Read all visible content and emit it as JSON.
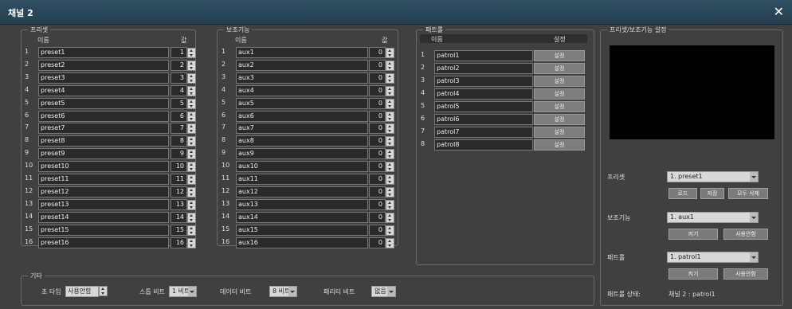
{
  "window": {
    "title": "채널 2"
  },
  "preset": {
    "legend": "프리셋",
    "col_name": "이름",
    "col_value": "값",
    "rows": [
      {
        "num": "1",
        "name": "preset1",
        "value": "1"
      },
      {
        "num": "2",
        "name": "preset2",
        "value": "2"
      },
      {
        "num": "3",
        "name": "preset3",
        "value": "3"
      },
      {
        "num": "4",
        "name": "preset4",
        "value": "4"
      },
      {
        "num": "5",
        "name": "preset5",
        "value": "5"
      },
      {
        "num": "6",
        "name": "preset6",
        "value": "6"
      },
      {
        "num": "7",
        "name": "preset7",
        "value": "7"
      },
      {
        "num": "8",
        "name": "preset8",
        "value": "8"
      },
      {
        "num": "9",
        "name": "preset9",
        "value": "9"
      },
      {
        "num": "10",
        "name": "preset10",
        "value": "10"
      },
      {
        "num": "11",
        "name": "preset11",
        "value": "11"
      },
      {
        "num": "12",
        "name": "preset12",
        "value": "12"
      },
      {
        "num": "13",
        "name": "preset13",
        "value": "13"
      },
      {
        "num": "14",
        "name": "preset14",
        "value": "14"
      },
      {
        "num": "15",
        "name": "preset15",
        "value": "15"
      },
      {
        "num": "16",
        "name": "preset16",
        "value": "16"
      }
    ]
  },
  "aux": {
    "legend": "보조기능",
    "col_name": "이름",
    "col_value": "값",
    "rows": [
      {
        "num": "1",
        "name": "aux1",
        "value": "0"
      },
      {
        "num": "2",
        "name": "aux2",
        "value": "0"
      },
      {
        "num": "3",
        "name": "aux3",
        "value": "0"
      },
      {
        "num": "4",
        "name": "aux4",
        "value": "0"
      },
      {
        "num": "5",
        "name": "aux5",
        "value": "0"
      },
      {
        "num": "6",
        "name": "aux6",
        "value": "0"
      },
      {
        "num": "7",
        "name": "aux7",
        "value": "0"
      },
      {
        "num": "8",
        "name": "aux8",
        "value": "0"
      },
      {
        "num": "9",
        "name": "aux9",
        "value": "0"
      },
      {
        "num": "10",
        "name": "aux10",
        "value": "0"
      },
      {
        "num": "11",
        "name": "aux11",
        "value": "0"
      },
      {
        "num": "12",
        "name": "aux12",
        "value": "0"
      },
      {
        "num": "13",
        "name": "aux13",
        "value": "0"
      },
      {
        "num": "14",
        "name": "aux14",
        "value": "0"
      },
      {
        "num": "15",
        "name": "aux15",
        "value": "0"
      },
      {
        "num": "16",
        "name": "aux16",
        "value": "0"
      }
    ]
  },
  "patrol": {
    "legend": "패트롤",
    "col_name": "이름",
    "col_setting": "설정",
    "rows": [
      {
        "num": "1",
        "name": "patrol1",
        "btn": "설정"
      },
      {
        "num": "2",
        "name": "patrol2",
        "btn": "설정"
      },
      {
        "num": "3",
        "name": "patrol3",
        "btn": "설정"
      },
      {
        "num": "4",
        "name": "patrol4",
        "btn": "설정"
      },
      {
        "num": "5",
        "name": "patrol5",
        "btn": "설정"
      },
      {
        "num": "6",
        "name": "patrol6",
        "btn": "설정"
      },
      {
        "num": "7",
        "name": "patrol7",
        "btn": "설정"
      },
      {
        "num": "8",
        "name": "patrol8",
        "btn": "설정"
      }
    ]
  },
  "settings": {
    "legend": "프리셋/보조기능 설정",
    "preset_label": "프리셋",
    "preset_select": "1. preset1",
    "btn_load": "로드",
    "btn_save": "저장",
    "btn_delete_all": "모두 삭제",
    "aux_label": "보조기능",
    "aux_select": "1. aux1",
    "btn_aux_on": "켜기",
    "btn_aux_custom": "사용안함",
    "patrol_label": "패트롤",
    "patrol_select": "1. patrol1",
    "btn_patrol_on": "켜기",
    "btn_patrol_custom": "사용안함",
    "status_label": "패트롤 상태:",
    "status_value": "채널 2 : patrol1"
  },
  "etc": {
    "legend": "기타",
    "focus_label": "초 타임",
    "focus_value": "사용안함",
    "zoom_label": "스톱 비트",
    "zoom_value": "1 비트",
    "data_label": "데이터 비트",
    "data_value": "8 비트",
    "parity_label": "패리티 비트",
    "parity_value": "없음"
  }
}
